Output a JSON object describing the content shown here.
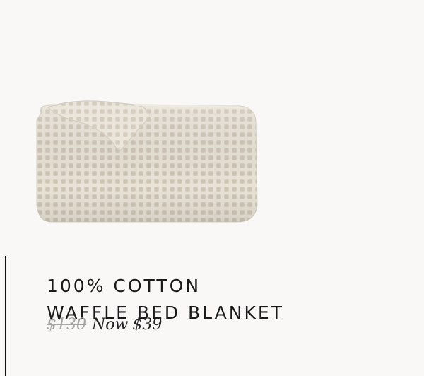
{
  "product": {
    "image_alt": "waffle bed blanket",
    "title_line1": "100% COTTON",
    "title_line2": "WAFFLE BED BLANKET",
    "original_price": "$130",
    "now_label": "Now",
    "sale_price": "$39"
  },
  "colors": {
    "background": "#f9f8f6",
    "blanket": "#e6e0d4",
    "text": "#1a1a1a",
    "strikethrough": "#a7a5a2"
  }
}
